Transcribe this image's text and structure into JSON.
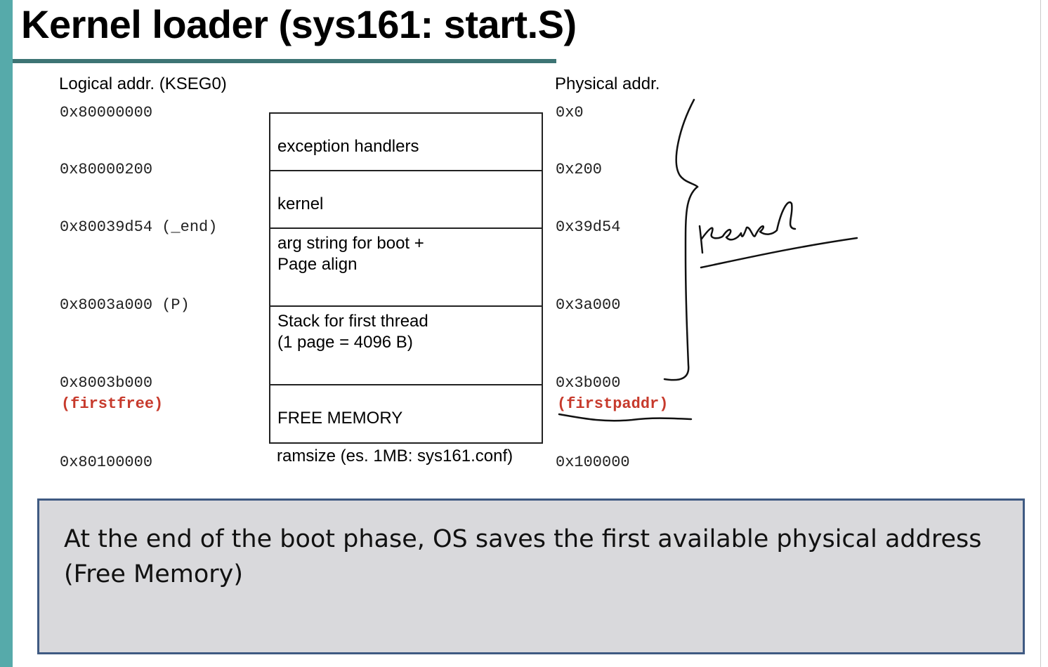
{
  "title": "Kernel loader (sys161: start.S)",
  "logical_header": "Logical addr. (KSEG0)",
  "physical_header": "Physical addr.",
  "logical_addresses": [
    "0x80000000",
    "0x80000200",
    "0x80039d54 (_end)",
    "0x8003a000 (P)",
    "0x8003b000",
    "0x80100000"
  ],
  "logical_note": "(firstfree)",
  "physical_addresses": [
    "0x0",
    "0x200",
    "0x39d54",
    "0x3a000",
    "0x3b000",
    "0x100000"
  ],
  "physical_note": "(firstpaddr)",
  "segments": [
    {
      "label": "exception handlers"
    },
    {
      "label": "kernel"
    },
    {
      "label": "arg string for boot +\nPage align"
    },
    {
      "label": "Stack for first thread\n(1 page = 4096 B)"
    },
    {
      "label": "FREE MEMORY"
    }
  ],
  "ramsize_label": "ramsize (es. 1MB: sys161.conf)",
  "handwritten_annotation": "kernel",
  "note": "At the end of the boot phase, OS saves the first available physical address (Free Memory)",
  "colors": {
    "accent_bar": "#56aaaa",
    "title_rule": "#3d7474",
    "highlight_red": "#c73a2c",
    "note_bg": "#d9d9dc",
    "note_border": "#3f5a82"
  }
}
